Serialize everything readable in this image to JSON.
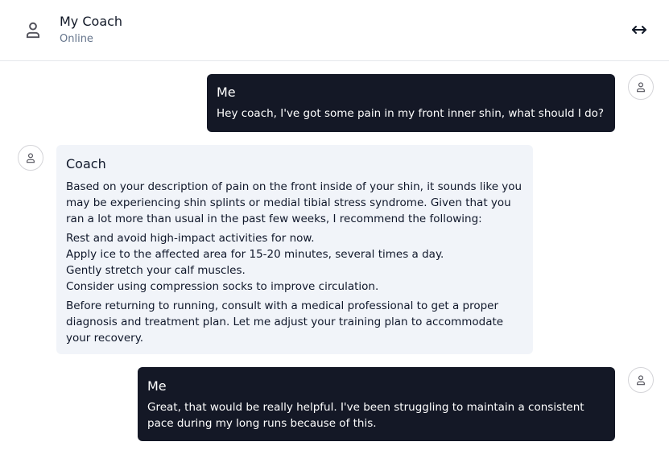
{
  "header": {
    "title": "My Coach",
    "status": "Online",
    "icons": {
      "avatar": "user-icon",
      "expand": "arrow-left-right-icon"
    }
  },
  "colors": {
    "me_bubble": "#141826",
    "coach_bubble": "#f1f4f9",
    "status_text": "#64748b"
  },
  "messages": [
    {
      "sender": "Me",
      "text": "Hey coach, I've got some pain in my front inner shin, what should I do?"
    },
    {
      "sender": "Coach",
      "intro": "Based on your description of pain on the front inside of your shin, it sounds like you may be experiencing shin splints or medial tibial stress syndrome. Given that you ran a lot more than usual in the past few weeks, I recommend the following:",
      "list": [
        "Rest and avoid high-impact activities for now.",
        "Apply ice to the affected area for 15-20 minutes, several times a day.",
        "Gently stretch your calf muscles.",
        "Consider using compression socks to improve circulation."
      ],
      "outro": "Before returning to running, consult with a medical professional to get a proper diagnosis and treatment plan. Let me adjust your training plan to accommodate your recovery."
    },
    {
      "sender": "Me",
      "text": "Great, that would be really helpful. I've been struggling to maintain a consistent pace during my long runs because of this."
    }
  ]
}
